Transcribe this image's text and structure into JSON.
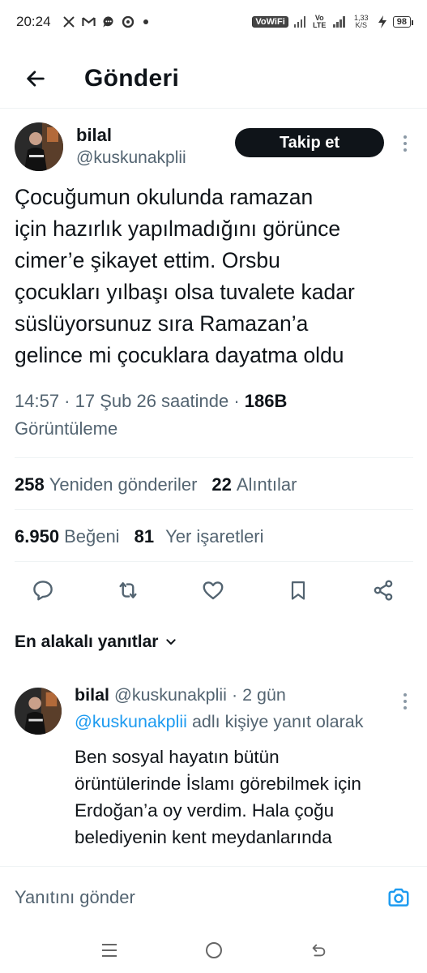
{
  "status_bar": {
    "time": "20:24",
    "notification_icons": [
      "x-icon",
      "gmail-icon",
      "message-icon",
      "sync-icon",
      "dot-icon"
    ],
    "vowifi": "VoWiFi",
    "network": "Vo LTE",
    "speed": "1,33 K/S",
    "battery": "98"
  },
  "header": {
    "title": "Gönderi"
  },
  "post": {
    "display_name": "bilal",
    "handle": "@kuskunakplii",
    "follow_label": "Takip et",
    "text": "Çocuğumun okulunda ramazan\niçin hazırlık yapılmadığını görünce\ncimer’e şikayet ettim. Orsbu\nçocukları yılbaşı olsa tuvalete kadar\nsüslüyorsunuz sıra Ramazan’a\ngelince mi çocuklara dayatma oldu",
    "time": "14:57",
    "date": "17 Şub 26 saatinde",
    "views": "186B",
    "views_label": "Görüntüleme",
    "reposts": "258",
    "reposts_label": "Yeniden gönderiler",
    "quotes": "22",
    "quotes_label": "Alıntılar",
    "likes": "6.950",
    "likes_label": "Beğeni",
    "bookmarks": "81",
    "bookmarks_label": "Yer işaretleri"
  },
  "replies": {
    "sort_label": "En alakalı yanıtlar",
    "items": [
      {
        "display_name": "bilal",
        "handle": "@kuskunakplii",
        "age": "2 gün",
        "reply_to_mention": "@kuskunakplii",
        "reply_to_suffix": "adlı kişiye yanıt olarak",
        "text": "Ben sosyal hayatın bütün\nörüntülerinde İslamı görebilmek için\nErdoğan’a oy verdim. Hala çoğu\nbelediyenin kent meydanlarında"
      }
    ]
  },
  "composer": {
    "placeholder": "Yanıtını gönder"
  },
  "colors": {
    "text": "#0f1419",
    "secondary": "#536471",
    "accent": "#1d9bf0",
    "follow_bg": "#0f1419"
  }
}
